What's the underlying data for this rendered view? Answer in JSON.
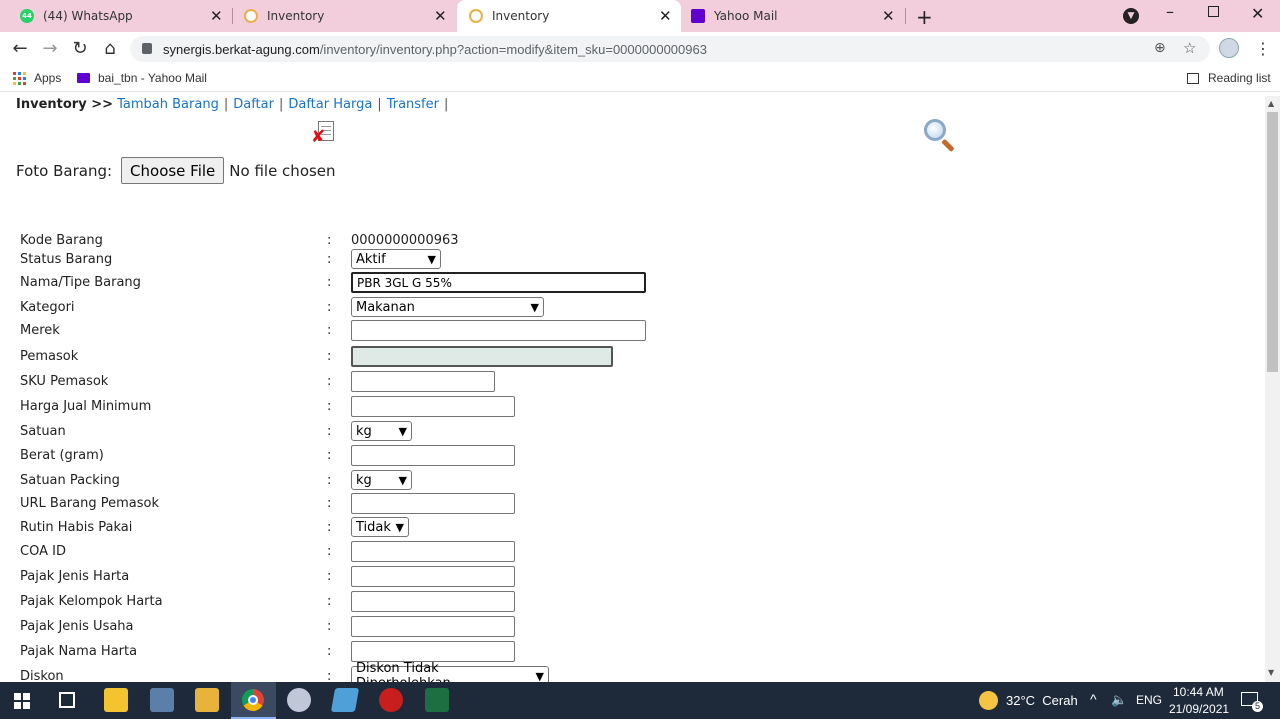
{
  "browser": {
    "tabs": [
      {
        "title": "(44) WhatsApp",
        "badge": "44"
      },
      {
        "title": "Inventory"
      },
      {
        "title": "Inventory"
      },
      {
        "title": "Yahoo Mail"
      }
    ],
    "url_domain": "synergis.berkat-agung.com",
    "url_path": "/inventory/inventory.php?action=modify&item_sku=0000000000963",
    "bookmarks": [
      "Apps",
      "bai_tbn - Yahoo Mail"
    ],
    "reading_list": "Reading list"
  },
  "nav": {
    "title": "Inventory >>",
    "links": [
      "Tambah Barang",
      "Daftar",
      "Daftar Harga",
      "Transfer"
    ]
  },
  "foto": {
    "label": "Foto Barang:",
    "button": "Choose File",
    "status": "No file chosen"
  },
  "form": {
    "kode_barang": {
      "label": "Kode Barang",
      "value": "0000000000963"
    },
    "status_barang": {
      "label": "Status Barang",
      "value": "Aktif"
    },
    "nama_tipe": {
      "label": "Nama/Tipe Barang",
      "value": "PBR 3GL G 55%"
    },
    "kategori": {
      "label": "Kategori",
      "value": "Makanan"
    },
    "merek": {
      "label": "Merek",
      "value": ""
    },
    "pemasok": {
      "label": "Pemasok",
      "value": ""
    },
    "sku_pemasok": {
      "label": "SKU Pemasok",
      "value": ""
    },
    "harga_jual_min": {
      "label": "Harga Jual Minimum",
      "value": ""
    },
    "satuan": {
      "label": "Satuan",
      "value": "kg"
    },
    "berat": {
      "label": "Berat (gram)",
      "value": ""
    },
    "satuan_packing": {
      "label": "Satuan Packing",
      "value": "kg"
    },
    "url_barang": {
      "label": "URL Barang Pemasok",
      "value": ""
    },
    "rutin": {
      "label": "Rutin Habis Pakai",
      "value": "Tidak"
    },
    "coa_id": {
      "label": "COA ID",
      "value": ""
    },
    "pajak_jenis_harta": {
      "label": "Pajak Jenis Harta",
      "value": ""
    },
    "pajak_kelompok_harta": {
      "label": "Pajak Kelompok Harta",
      "value": ""
    },
    "pajak_jenis_usaha": {
      "label": "Pajak Jenis Usaha",
      "value": ""
    },
    "pajak_nama_harta": {
      "label": "Pajak Nama Harta",
      "value": ""
    },
    "diskon": {
      "label": "Diskon",
      "value": "Diskon Tidak Diperbolehkan"
    },
    "colon": ":"
  },
  "taskbar": {
    "weather": "32°C  Cerah",
    "lang": "ENG",
    "time": "10:44 AM",
    "date": "21/09/2021",
    "notif_count": "5"
  },
  "colors": {
    "tabstrip": "#f2cedd",
    "link": "#1a73c8",
    "pemasok_bg": "#dfe9e6",
    "taskbar": "#1e2a3a"
  }
}
